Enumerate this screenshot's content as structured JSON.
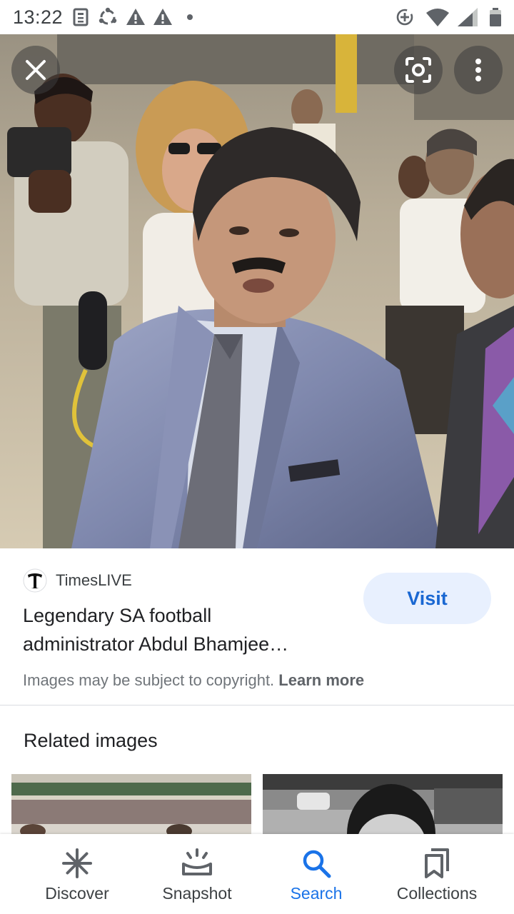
{
  "status_bar": {
    "time": "13:22",
    "left_icons": [
      "news-icon",
      "sync-icon",
      "warning-icon",
      "warning-icon",
      "dot-icon"
    ],
    "right_icons": [
      "data-saver-icon",
      "wifi-icon",
      "signal-icon",
      "battery-icon"
    ]
  },
  "image_viewer": {
    "close_icon": "close-icon",
    "lens_icon": "google-lens-icon",
    "menu_icon": "more-vert-icon"
  },
  "result": {
    "source_name": "TimesLIVE",
    "title_line1": "Legendary SA football",
    "title_line2": "administrator Abdul Bhamjee…",
    "visit_label": "Visit",
    "copyright_text": "Images may be subject to copyright.",
    "learn_more_label": "Learn more"
  },
  "related": {
    "title": "Related images"
  },
  "bottom_nav": {
    "items": [
      {
        "label": "Discover",
        "icon": "asterisk-icon"
      },
      {
        "label": "Snapshot",
        "icon": "snapshot-icon"
      },
      {
        "label": "Search",
        "icon": "search-icon"
      },
      {
        "label": "Collections",
        "icon": "bookmarks-icon"
      }
    ],
    "active": "Search"
  },
  "colors": {
    "accent": "#1a73e8",
    "visit_bg": "#e8f0fe",
    "visit_text": "#1967d2",
    "text_primary": "#202124",
    "text_secondary": "#70757a"
  }
}
